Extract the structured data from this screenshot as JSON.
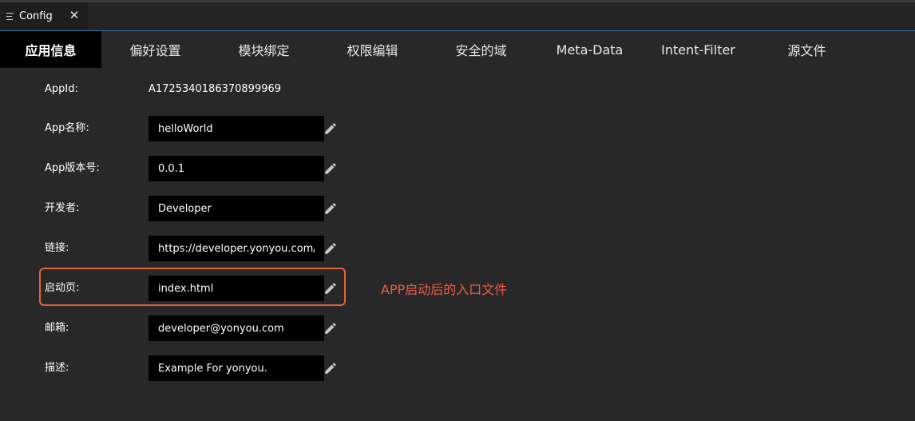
{
  "editor_tab": {
    "title": "Config",
    "close_glyph": "✕"
  },
  "nav": {
    "tabs": [
      {
        "label": "应用信息",
        "active": true
      },
      {
        "label": "偏好设置",
        "active": false
      },
      {
        "label": "模块绑定",
        "active": false
      },
      {
        "label": "权限编辑",
        "active": false
      },
      {
        "label": "安全的域",
        "active": false
      },
      {
        "label": "Meta-Data",
        "active": false
      },
      {
        "label": "Intent-Filter",
        "active": false
      },
      {
        "label": "源文件",
        "active": false
      }
    ]
  },
  "form": {
    "appid": {
      "label": "AppId:",
      "value": "A1725340186370899969"
    },
    "fields": [
      {
        "label": "App名称:",
        "value": "helloWorld"
      },
      {
        "label": "App版本号:",
        "value": "0.0.1"
      },
      {
        "label": "开发者:",
        "value": "Developer"
      },
      {
        "label": "链接:",
        "value": "https://developer.yonyou.com/"
      },
      {
        "label": "启动页:",
        "value": "index.html"
      },
      {
        "label": "邮箱:",
        "value": "developer@yonyou.com"
      },
      {
        "label": "描述:",
        "value": "Example For yonyou."
      }
    ]
  },
  "annotation": {
    "text": "APP启动后的入口文件"
  },
  "colors": {
    "background": "#282828",
    "active_tab": "#000000",
    "input_bg": "#000000",
    "highlight": "#e8613a",
    "annotation": "#ef5a4a",
    "tab_border": "#2f6fa8"
  }
}
